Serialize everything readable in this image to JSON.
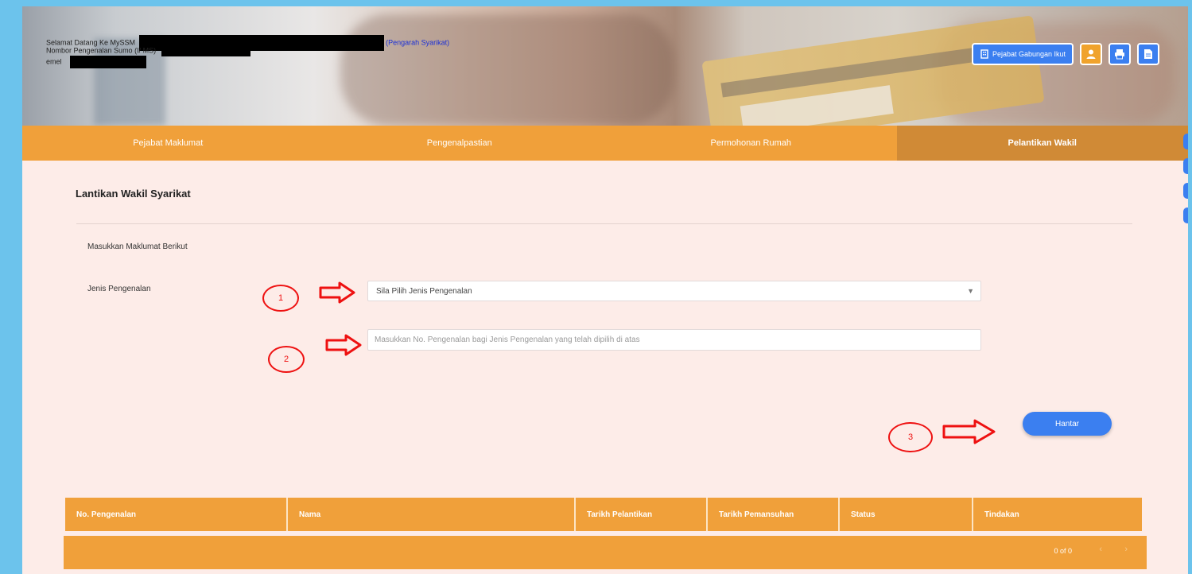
{
  "header": {
    "user": {
      "greeting": "Selamat Datang Ke MySSM",
      "role_link": "(Pengarah Syarikat)",
      "id_label": "Nombor Pengenalan Sumo (I/ MS)",
      "email_label": "emel"
    },
    "actions": {
      "primary_label": "Pejabat Gabungan Ikut",
      "profile_icon": "user-icon",
      "print_icon": "print-icon",
      "doc_icon": "document-icon"
    }
  },
  "nav": {
    "tabs": [
      {
        "label": "Pejabat Maklumat",
        "active": false
      },
      {
        "label": "Pengenalpastian",
        "active": false
      },
      {
        "label": "Permohonan Rumah",
        "active": false
      },
      {
        "label": "Pelantikan Wakil",
        "active": true
      }
    ]
  },
  "form": {
    "title": "Lantikan Wakil Syarikat",
    "instruction": "Masukkan Maklumat Berikut",
    "type_label": "Jenis Pengenalan",
    "type_select_value": "Sila Pilih Jenis Pengenalan",
    "id_placeholder": "Masukkan No. Pengenalan bagi Jenis Pengenalan yang telah dipilih di atas",
    "submit_label": "Hantar"
  },
  "annotations": {
    "step1": "1",
    "step2": "2",
    "step3": "3"
  },
  "table": {
    "columns": [
      "No. Pengenalan",
      "Nama",
      "Tarikh Pelantikan",
      "Tarikh Pemansuhan",
      "Status",
      "Tindakan"
    ],
    "rows": [],
    "page_info": "0 of 0"
  },
  "colors": {
    "accent_orange": "#f0a03a",
    "active_tab": "#d08a36",
    "button_blue": "#3b7ff0",
    "annotation_red": "#e11111",
    "page_bg": "#fdece8"
  }
}
